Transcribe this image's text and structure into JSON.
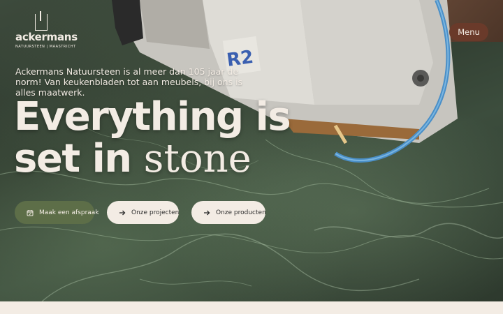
{
  "brand": {
    "name": "ackermans",
    "subtitle": "NATUURSTEEN | MAASTRICHT"
  },
  "nav": {
    "menu_label": "Menu"
  },
  "hero": {
    "intro": "Ackermans Natuursteen is al meer dan 105 jaar de norm! Van keukenbladen tot aan meubels, bij ons is alles maatwerk.",
    "headline_line1": "Everything is",
    "headline_line2_bold": "set in",
    "headline_line2_light": "stone",
    "machine_label": "R2"
  },
  "actions": {
    "appointment": {
      "label": "Maak een afspraak",
      "icon": "calendar-icon"
    },
    "projects": {
      "label": "Onze projecten",
      "icon": "arrow-right-icon"
    },
    "products": {
      "label": "Onze producten",
      "icon": "arrow-right-icon"
    }
  },
  "colors": {
    "cream": "#f3ece4",
    "menu_bg": "#6a3a2a",
    "primary_button": "#5d6e48",
    "marble": "#2f3b2f"
  }
}
